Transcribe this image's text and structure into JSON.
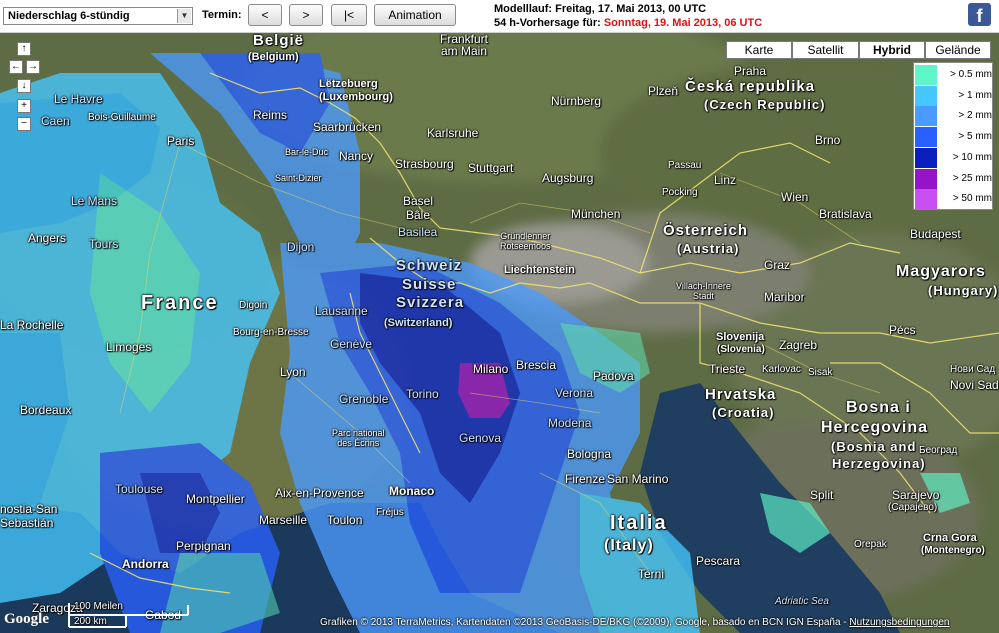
{
  "toolbar": {
    "layer_select_value": "Niederschlag 6-stündig",
    "termin_label": "Termin:",
    "prev_label": "<",
    "next_label": ">",
    "first_label": "|<",
    "animation_label": "Animation",
    "modelllauf_text": "Modelllauf: Freitag, 17. Mai 2013, 00 UTC",
    "forecast_prefix": "54 h-Vorhersage für: ",
    "forecast_date": "Sonntag, 19. Mai 2013, 06 UTC",
    "facebook_glyph": "f"
  },
  "map_controls": {
    "pan_up": "↑",
    "pan_left": "←",
    "pan_right": "→",
    "pan_down": "↓",
    "zoom_in": "+",
    "zoom_out": "−"
  },
  "map_types": [
    {
      "label": "Karte",
      "active": false
    },
    {
      "label": "Satellit",
      "active": false
    },
    {
      "label": "Hybrid",
      "active": true
    },
    {
      "label": "Gelände",
      "active": false
    }
  ],
  "legend": [
    {
      "label": "> 0.5 mm",
      "color": "#5ff5c8"
    },
    {
      "label": "> 1 mm",
      "color": "#46c8ff"
    },
    {
      "label": "> 2 mm",
      "color": "#4b9bff"
    },
    {
      "label": "> 5 mm",
      "color": "#2861ff"
    },
    {
      "label": "> 10 mm",
      "color": "#0a1ebe"
    },
    {
      "label": "> 25 mm",
      "color": "#9614c8"
    },
    {
      "label": "> 50 mm",
      "color": "#c850f0"
    }
  ],
  "labels": {
    "belgie": "België",
    "belgium": "(Belgium)",
    "frankfurt": "Frankfurt\nam Main",
    "letzebuerg": "Lëtzebuerg",
    "luxembourg": "(Luxembourg)",
    "nurnberg": "Nürnberg",
    "plzen": "Plzeň",
    "ceska": "Česká republika",
    "czech": "(Czech Republic)",
    "praha": "Praha",
    "le_havre": "Le Havre",
    "caen": "Caen",
    "bois": "Bois-Guillaume",
    "reims": "Reims",
    "saarbrucken": "Saarbrücken",
    "karlsruhe": "Karlsruhe",
    "brno": "Brno",
    "paris": "Paris",
    "nancy": "Nancy",
    "barleduc": "Bar-le-Duc",
    "stuttgart": "Stuttgart",
    "augsburg": "Augsburg",
    "passau": "Passau",
    "strasbourg": "Strasbourg",
    "linz": "Linz",
    "le_mans": "Le Mans",
    "saintdizier": "Saint-Dizier",
    "pocking": "Pocking",
    "wien": "Wien",
    "basel": "Basel",
    "bale": "Bâle",
    "munchen": "München",
    "bratislava": "Bratislava",
    "angers": "Angers",
    "tours": "Tours",
    "basilea": "Basilea",
    "grundlenner": "Gründlenner\nRotseemoos",
    "osterreich": "Österreich",
    "austria": "(Austria)",
    "budapest": "Budapest",
    "dijon": "Dijon",
    "schweiz": "Schweiz",
    "suisse": "Suisse",
    "svizzera": "Svizzera",
    "switzerland": "(Switzerland)",
    "liechtenstein": "Liechtenstein",
    "graz": "Graz",
    "magyarorszag": "Magyarors",
    "hungary": "(Hungary)",
    "france": "France",
    "villach": "Villach-Innere\nStadt",
    "maribor": "Maribor",
    "digoin": "Digoin",
    "la_rochelle": "La Rochelle",
    "bourg": "Bourg-en-Bresse",
    "lausanne": "Lausanne",
    "slovenija": "Slovenija",
    "slovenia": "(Slovenia)",
    "pecs": "Pécs",
    "limoges": "Limoges",
    "geneve": "Genève",
    "zagreb": "Zagreb",
    "lyon": "Lyon",
    "milano": "Milano",
    "brescia": "Brescia",
    "trieste": "Trieste",
    "karlovac": "Karlovac",
    "sisak": "Sisak",
    "novisad": "Нови Сад",
    "novisad_lat": "Novi Sad",
    "padova": "Padova",
    "bordeaux": "Bordeaux",
    "verona": "Verona",
    "torino": "Torino",
    "hrvatska": "Hrvatska",
    "croatia": "(Croatia)",
    "bosna": "Bosna i",
    "hercegovina": "Hercegovina",
    "bosnia": "(Bosnia and",
    "herzegovina": "Herzegovina)",
    "grenoble": "Grenoble",
    "ecrins": "Parc national\ndes Écrins",
    "modena": "Modena",
    "genova": "Genova",
    "bologna": "Bologna",
    "beograd": "Београд",
    "firenze": "Firenze",
    "san_marino": "San Marino",
    "toulouse": "Toulouse",
    "montpellier": "Montpellier",
    "aix": "Aix-en-Provence",
    "monaco": "Monaco",
    "split": "Split",
    "sarajevo": "Sarajevo",
    "sarajevo_cyr": "(Сарајево)",
    "donostia": "nostia-San",
    "sebastian": "Sebastián",
    "marseille": "Marseille",
    "toulon": "Toulon",
    "frejus": "Fréjus",
    "italia": "Italia",
    "italy": "(Italy)",
    "orepak": "Orepak",
    "perpignan": "Perpignan",
    "crna_gora": "Crna Gora",
    "montenegro": "(Montenegro)",
    "andorra": "Andorra",
    "terni": "Terni",
    "pescara": "Pescara",
    "zaragoza": "Zaragoza",
    "adriatic": "Adriatic Sea",
    "gabod": "Gabod",
    "google_left": "Google"
  },
  "scale": {
    "miles": "100 Meilen",
    "km": "200 km"
  },
  "copyright": "Grafiken © 2013 TerraMetrics, Kartendaten ©2013 GeoBasis-DE/BKG (©2009), Google, basado en BCN IGN España - ",
  "terms_link": "Nutzungsbedingungen"
}
